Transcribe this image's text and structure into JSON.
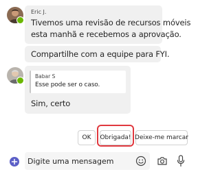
{
  "messages": [
    {
      "sender": "Eric J.",
      "avatar_icon": "person-avatar-icon",
      "presence": "available",
      "lines": [
        "Tivemos uma revisão de recursos móveis",
        "esta manhã e recebemos a aprovação."
      ]
    },
    {
      "sender": "",
      "lines": [
        "Compartilhe com a equipe para FYI."
      ]
    },
    {
      "sender": "",
      "avatar_icon": "person-avatar-icon",
      "presence": "available",
      "quote": {
        "author": "Babar S",
        "text": "Esse pode ser o caso."
      },
      "lines": [
        "Sim, certo"
      ]
    }
  ],
  "suggested_replies": [
    {
      "label": "OK"
    },
    {
      "label": "Obrigada!",
      "highlighted": true
    },
    {
      "label": "Deixe-me marcar"
    }
  ],
  "compose": {
    "placeholder": "Digite uma mensagem",
    "value": ""
  },
  "icons": {
    "add": "add-circle-icon",
    "emoji": "emoji-icon",
    "camera": "camera-icon",
    "mic": "microphone-icon"
  },
  "colors": {
    "accent": "#5b5fc7",
    "presence": "#6bb700",
    "highlight": "#e0383e",
    "bubble": "#f0f0f0"
  }
}
